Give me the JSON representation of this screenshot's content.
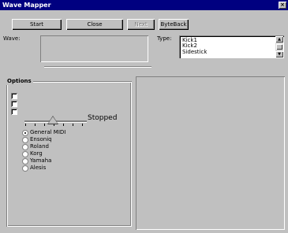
{
  "window": {
    "title": "Wave Mapper",
    "close_glyph": "×"
  },
  "toolbar": {
    "start_label": "Start",
    "close_label": "Close",
    "next_label": "Next",
    "byteback_label": "ByteBack"
  },
  "wave": {
    "label": "Wave:",
    "value": ""
  },
  "type": {
    "label": "Type:",
    "items": [
      "Kick1",
      "Kick2",
      "Sidestick"
    ]
  },
  "options": {
    "label": "Options",
    "checkboxes": [
      false,
      false,
      false
    ],
    "slider": {
      "value_fraction": 0.45
    },
    "status_text": "Stopped",
    "radios": [
      {
        "label": "General MIDI",
        "selected": true
      },
      {
        "label": "Ensoniq",
        "selected": false
      },
      {
        "label": "Roland",
        "selected": false
      },
      {
        "label": "Korg",
        "selected": false
      },
      {
        "label": "Yamaha",
        "selected": false
      },
      {
        "label": "Alesis",
        "selected": false
      }
    ]
  }
}
